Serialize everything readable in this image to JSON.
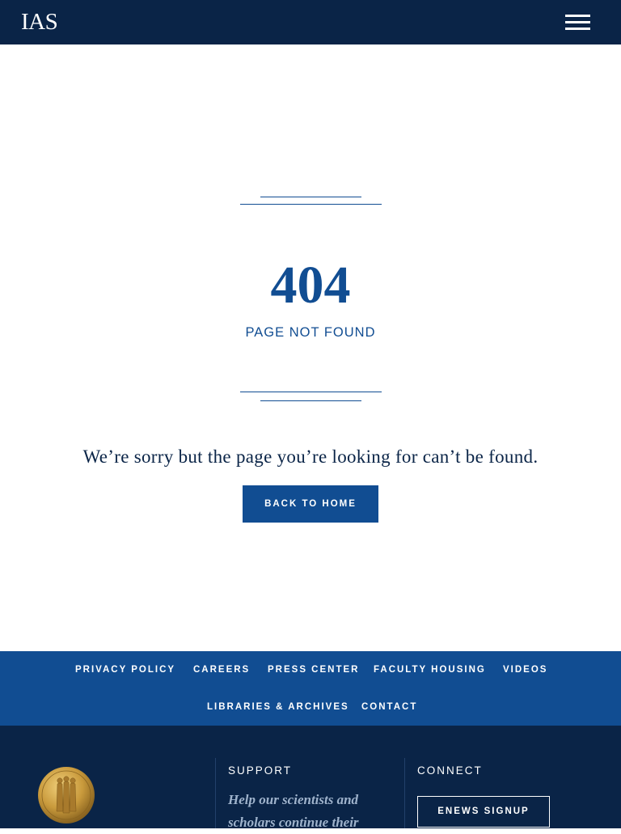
{
  "header": {
    "logo_text": "IAS",
    "menu_icon": "hamburger-menu-icon"
  },
  "error": {
    "code": "404",
    "subtitle": "PAGE NOT FOUND",
    "message": "We’re sorry but the page you’re looking for can’t be found.",
    "home_button": "BACK TO HOME"
  },
  "footer_links": {
    "privacy": "PRIVACY POLICY",
    "careers": "CAREERS",
    "press": "PRESS CENTER",
    "housing": "FACULTY HOUSING",
    "videos": "VIDEOS",
    "libraries": "LIBRARIES & ARCHIVES",
    "contact": "CONTACT"
  },
  "footer": {
    "medal_icon": "ias-medal-icon",
    "support_title": "SUPPORT",
    "support_text": "Help our scientists and scholars continue their",
    "connect_title": "CONNECT",
    "enews_button": "ENEWS SIGNUP"
  },
  "colors": {
    "navy": "#0a2447",
    "blue": "#114d92",
    "white": "#ffffff"
  }
}
